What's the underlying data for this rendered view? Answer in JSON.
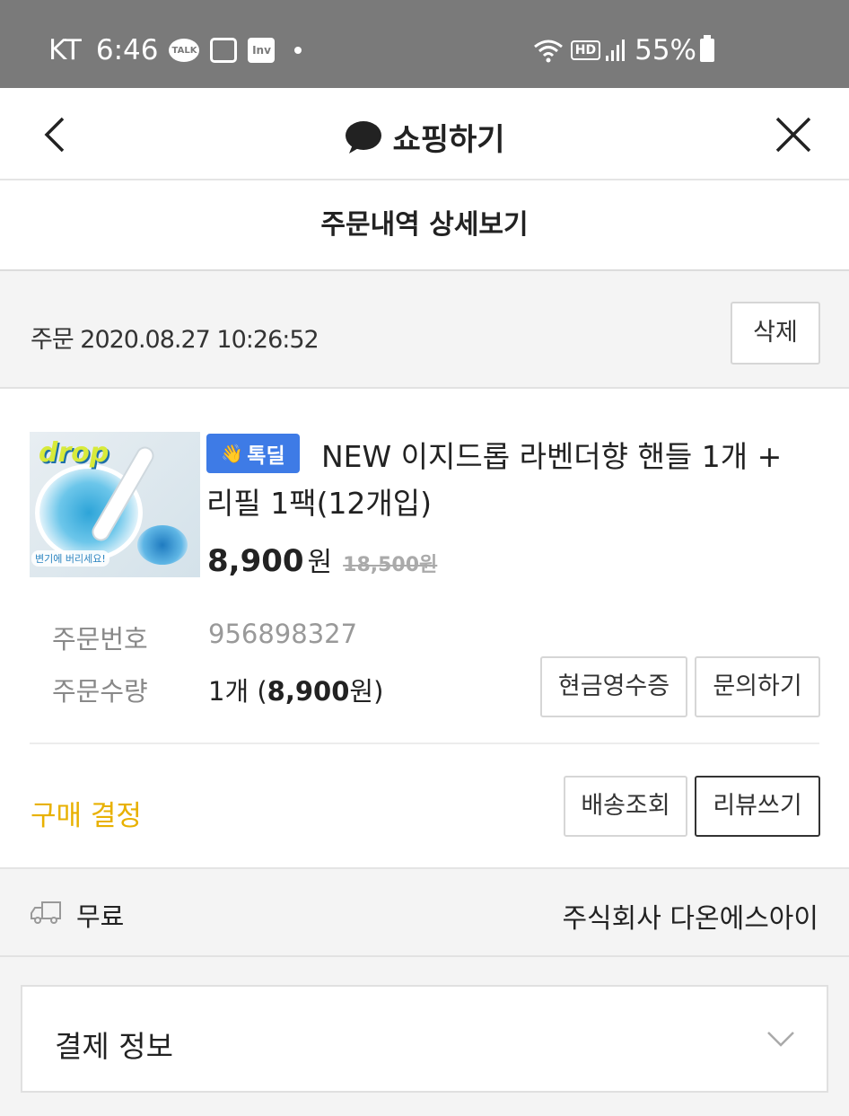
{
  "status_bar": {
    "carrier": "KT",
    "time": "6:46",
    "talk_icon_text": "TALK",
    "inv_icon_text": "Inv",
    "hd_label": "HD",
    "battery": "55%"
  },
  "header": {
    "title": "쇼핑하기"
  },
  "subheader": {
    "title": "주문내역 상세보기"
  },
  "order": {
    "date_label": "주문 2020.08.27 10:26:52",
    "delete_label": "삭제"
  },
  "product": {
    "badge_label": "톡딜",
    "name": "NEW 이지드롭 라벤더향 핸들 1개 + 리필 1팩(12개입)",
    "sale_price": "8,900",
    "won_unit": "원",
    "original_price": "18,500원",
    "image_brand_text": "drop",
    "image_caption": "변기에 버리세요!"
  },
  "info": {
    "order_number_label": "주문번호",
    "order_number": "956898327",
    "quantity_label": "주문수량",
    "quantity_prefix": "1개 (",
    "quantity_price": "8,900",
    "quantity_suffix": "원)"
  },
  "actions": {
    "cash_receipt": "현금영수증",
    "inquiry": "문의하기",
    "tracking": "배송조회",
    "review": "리뷰쓰기"
  },
  "purchase_status": "구매 결정",
  "shipping": {
    "fee": "무료",
    "seller": "주식회사 다온에스아이"
  },
  "payment": {
    "title": "결제 정보"
  },
  "colors": {
    "status_bar_bg": "#7a7a7a",
    "badge_blue": "#3e7be6",
    "status_yellow": "#e8b100"
  },
  "icons": [
    "back-arrow-icon",
    "speech-bubble-icon",
    "close-icon",
    "truck-icon",
    "chevron-down-icon",
    "wave-hand-icon"
  ]
}
